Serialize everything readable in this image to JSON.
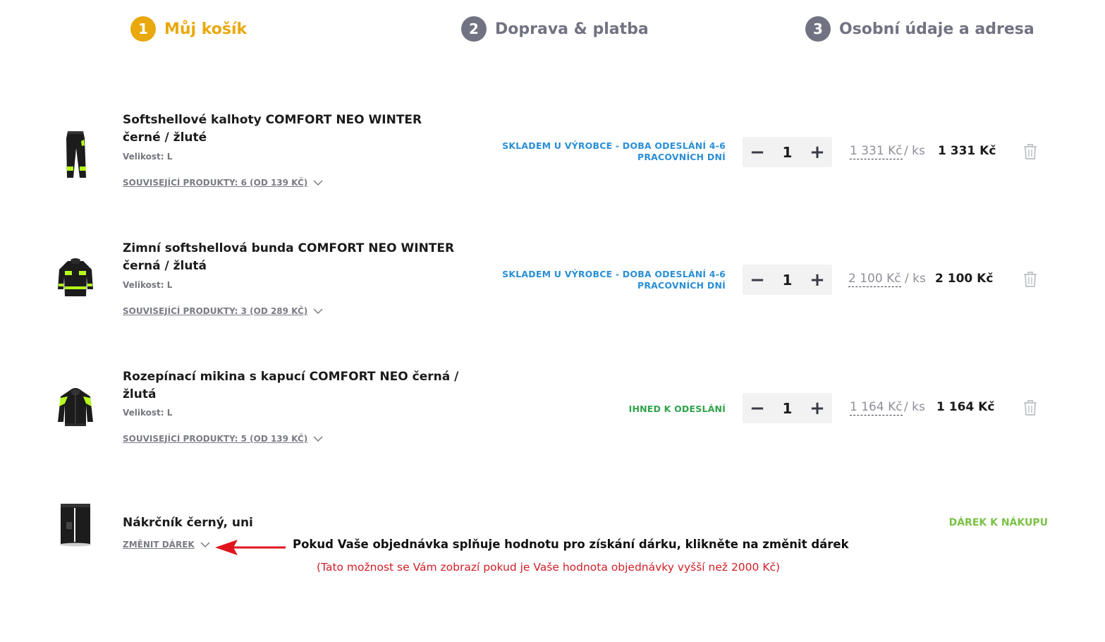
{
  "steps": [
    {
      "number": "1",
      "label": "Můj košík",
      "state": "active"
    },
    {
      "number": "2",
      "label": "Doprava & platba",
      "state": "inactive"
    },
    {
      "number": "3",
      "label": "Osobní údaje a adresa",
      "state": "inactive"
    }
  ],
  "items": [
    {
      "title": "Softshellové kalhoty COMFORT NEO WINTER černé / žluté",
      "size_label": "Velikost:",
      "size_value": "L",
      "related": "SOUVISEJÍCÍ PRODUKTY: 6 (OD 139 KČ)",
      "stock": "SKLADEM U VÝROBCE - DOBA ODESLÁNÍ 4-6 PRACOVNÍCH DNÍ",
      "stock_color": "#2a8fd6",
      "quantity": "1",
      "unit_price": "1 331 Kč",
      "per_unit": "/ ks",
      "total": "1 331 Kč",
      "image_icon": "trousers-icon"
    },
    {
      "title": "Zimní softshellová bunda COMFORT NEO WINTER černá / žlutá",
      "size_label": "Velikost:",
      "size_value": "L",
      "related": "SOUVISEJÍCÍ PRODUKTY: 3 (OD 289 KČ)",
      "stock": "SKLADEM U VÝROBCE - DOBA ODESLÁNÍ 4-6 PRACOVNÍCH DNÍ",
      "stock_color": "#2a8fd6",
      "quantity": "1",
      "unit_price": "2 100 Kč",
      "per_unit": "/ ks",
      "total": "2 100 Kč",
      "image_icon": "jacket-icon"
    },
    {
      "title": "Rozepínací mikina s kapucí COMFORT NEO černá / žlutá",
      "size_label": "Velikost:",
      "size_value": "L",
      "related": "SOUVISEJÍCÍ PRODUKTY: 5 (OD 139 KČ)",
      "stock": "IHNED K ODESLÁNÍ",
      "stock_color": "#2ea34a",
      "quantity": "1",
      "unit_price": "1 164 Kč",
      "per_unit": "/ ks",
      "total": "1 164 Kč",
      "image_icon": "hoodie-icon"
    }
  ],
  "gift": {
    "title": "Nákrčník černý, uni",
    "change_label": "ZMĚNIT DÁREK",
    "badge": "DÁREK K NÁKUPU",
    "image_icon": "neck-gaiter-icon",
    "note": "Pokud Vaše objednávka splňuje hodnotu pro získání dárku, klikněte na změnit dárek",
    "subnote": "(Tato možnost se Vám zobrazí pokud je Vaše hodnota objednávky vyšší  než 2000 Kč)"
  },
  "icons": {
    "qty_minus": "−",
    "qty_plus": "+",
    "trash": "trash-icon",
    "chevron": "chevron-down-icon",
    "arrow": "arrow-left-icon"
  },
  "colors": {
    "accent": "#e9a90c",
    "step_inactive": "#717382",
    "stock_blue": "#2a8fd6",
    "stock_green": "#2ea34a",
    "gift_green": "#7ac143",
    "note_red": "#d01f27"
  }
}
